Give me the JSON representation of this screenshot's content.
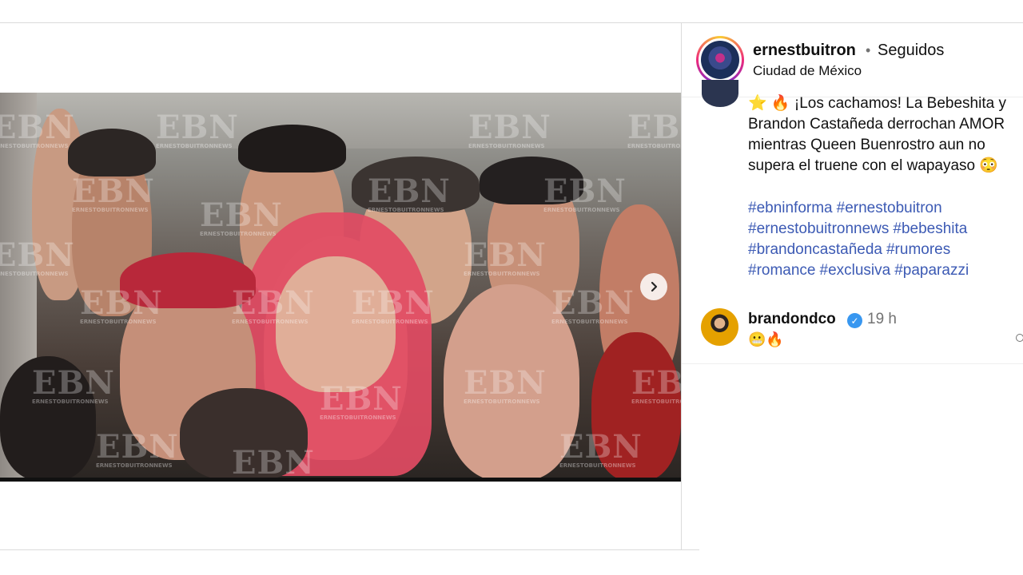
{
  "post": {
    "username": "ernestbuitron",
    "separator": "•",
    "follow_status": "Seguidos",
    "location": "Ciudad de México",
    "media": {
      "watermark": "EBN",
      "watermark_sub": "ERNESTOBUITRONNEWS",
      "next_icon": "chevron-right-icon",
      "slides_total": 2,
      "slide_active": 1
    },
    "caption": {
      "lines": [
        "⭐ 🔥 ¡Los cachamos! La Bebeshita y",
        "Brandon Castañeda derrochan AMOR",
        "mientras Queen Buenrostro aun no",
        "supera el truene con el wapayaso 😳"
      ],
      "hashtags": [
        [
          "#ebninforma",
          "#ernestobuitron"
        ],
        [
          "#ernestobuitronnews",
          "#bebeshita"
        ],
        [
          "#brandoncastañeda",
          "#rumores"
        ],
        [
          "#romance",
          "#exclusiva",
          "#paparazzi"
        ]
      ]
    },
    "comment": {
      "username": "brandondco",
      "verified_icon": "verified-badge-icon",
      "time": "19 h",
      "text": "😬🔥"
    }
  },
  "colors": {
    "hashtag": "#3c5ab4",
    "verified": "#3897f0",
    "muted": "#737373"
  }
}
